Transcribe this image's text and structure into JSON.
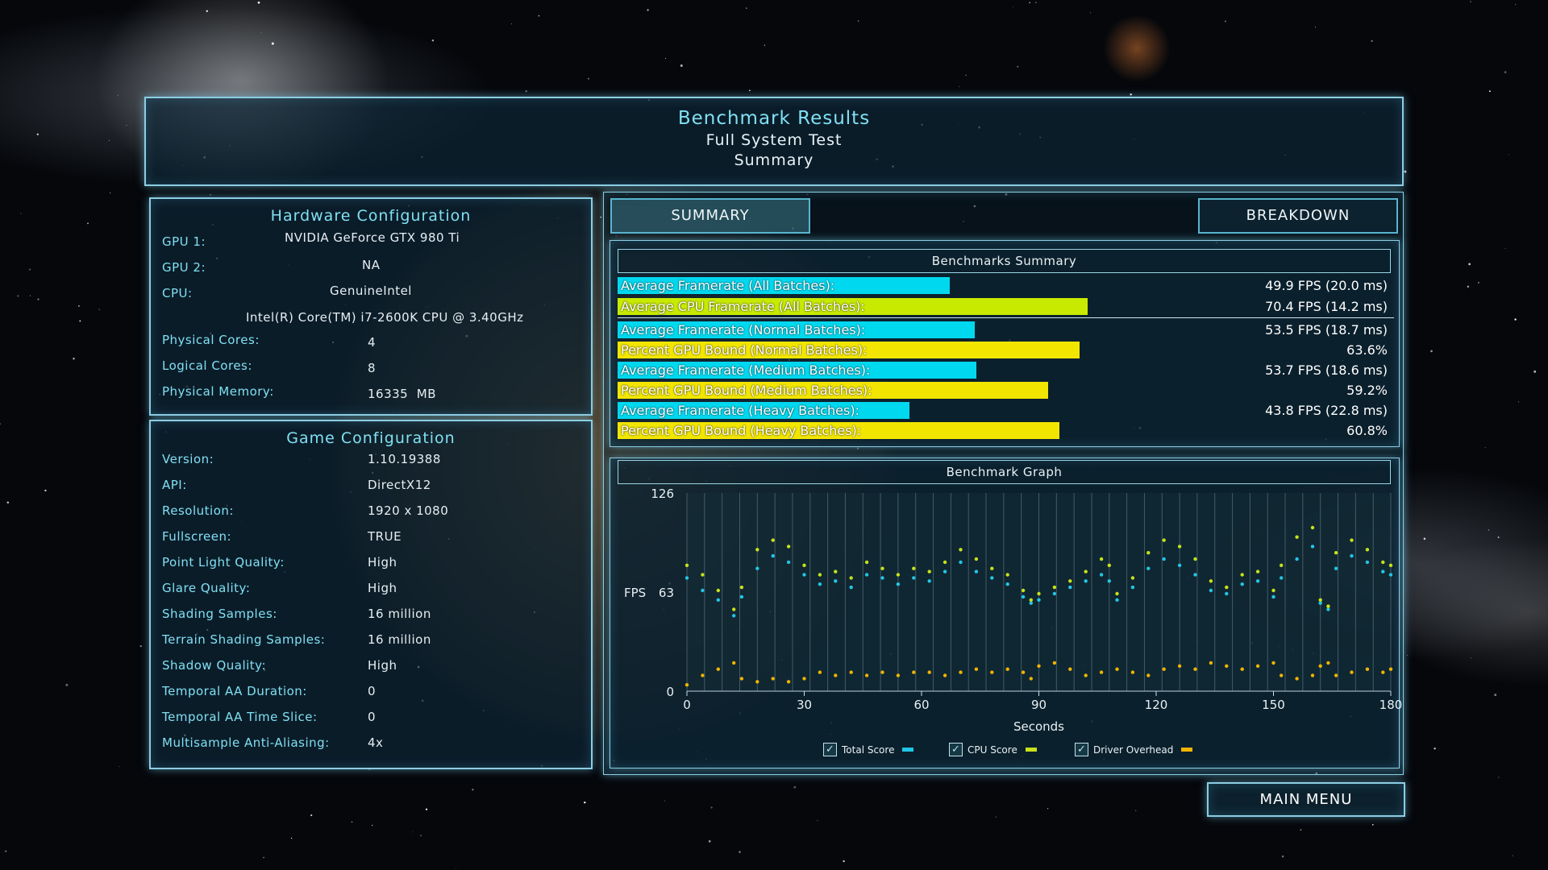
{
  "header": {
    "title": "Benchmark Results",
    "subtitle1": "Full System Test",
    "subtitle2": "Summary"
  },
  "hardware": {
    "title": "Hardware Configuration",
    "gpu1_label": "GPU 1:",
    "gpu1_value": "NVIDIA GeForce GTX 980 Ti",
    "gpu2_label": "GPU 2:",
    "gpu2_value": "NA",
    "cpu_label": "CPU:",
    "cpu_vendor": "GenuineIntel",
    "cpu_model": "Intel(R) Core(TM) i7-2600K CPU @ 3.40GHz",
    "cores_label": "Physical Cores:",
    "cores_value": "4",
    "logical_label": "Logical Cores:",
    "logical_value": "8",
    "memory_label": "Physical Memory:",
    "memory_value": "16335  MB"
  },
  "game": {
    "title": "Game Configuration",
    "rows": [
      {
        "label": "Version:",
        "value": "1.10.19388"
      },
      {
        "label": "API:",
        "value": "DirectX12"
      },
      {
        "label": "Resolution:",
        "value": "1920 x 1080"
      },
      {
        "label": "Fullscreen:",
        "value": "TRUE"
      },
      {
        "label": "Point Light Quality:",
        "value": "High"
      },
      {
        "label": "Glare Quality:",
        "value": "High"
      },
      {
        "label": "Shading Samples:",
        "value": "16 million"
      },
      {
        "label": "Terrain Shading Samples:",
        "value": "16 million"
      },
      {
        "label": "Shadow Quality:",
        "value": "High"
      },
      {
        "label": "Temporal AA Duration:",
        "value": "0"
      },
      {
        "label": "Temporal AA Time Slice:",
        "value": "0"
      },
      {
        "label": "Multisample Anti-Aliasing:",
        "value": "4x"
      }
    ]
  },
  "tabs": {
    "summary": "SUMMARY",
    "breakdown": "BREAKDOWN"
  },
  "summary": {
    "title": "Benchmarks Summary",
    "bars": [
      {
        "label": "Average Framerate (All Batches):",
        "value": "49.9 FPS (20.0 ms)",
        "fraction": 0.428,
        "color": "#00d8ef"
      },
      {
        "label": "Average CPU Framerate (All Batches):",
        "value": "70.4 FPS (14.2 ms)",
        "fraction": 0.605,
        "color": "#c8ea00"
      },
      {
        "label": "Average Framerate (Normal Batches):",
        "value": "53.5 FPS (18.7 ms)",
        "fraction": 0.46,
        "color": "#00d8ef"
      },
      {
        "label": "Percent GPU Bound (Normal Batches):",
        "value": "63.6%",
        "fraction": 0.595,
        "color": "#f2e600"
      },
      {
        "label": "Average Framerate (Medium Batches):",
        "value": "53.7 FPS (18.6 ms)",
        "fraction": 0.462,
        "color": "#00d8ef"
      },
      {
        "label": "Percent GPU Bound (Medium Batches):",
        "value": "59.2%",
        "fraction": 0.554,
        "color": "#f2e600"
      },
      {
        "label": "Average Framerate (Heavy Batches):",
        "value": "43.8 FPS (22.8 ms)",
        "fraction": 0.376,
        "color": "#00d8ef"
      },
      {
        "label": "Percent GPU Bound (Heavy Batches):",
        "value": "60.8%",
        "fraction": 0.569,
        "color": "#f2e600"
      }
    ]
  },
  "graph": {
    "title": "Benchmark Graph"
  },
  "chart_data": {
    "type": "scatter",
    "xlabel": "Seconds",
    "ylabel": "FPS",
    "xlim": [
      0,
      180
    ],
    "ylim": [
      0,
      126
    ],
    "x_ticks": [
      "0",
      "30",
      "60",
      "90",
      "120",
      "150",
      "180"
    ],
    "y_ticks": [
      "0",
      "63",
      "126"
    ],
    "series": [
      {
        "name": "Total Score",
        "color": "#22c6e6",
        "points": [
          [
            0,
            72
          ],
          [
            4,
            64
          ],
          [
            8,
            58
          ],
          [
            12,
            48
          ],
          [
            14,
            60
          ],
          [
            18,
            78
          ],
          [
            22,
            86
          ],
          [
            26,
            82
          ],
          [
            30,
            74
          ],
          [
            34,
            68
          ],
          [
            38,
            70
          ],
          [
            42,
            66
          ],
          [
            46,
            74
          ],
          [
            50,
            72
          ],
          [
            54,
            68
          ],
          [
            58,
            72
          ],
          [
            62,
            70
          ],
          [
            66,
            76
          ],
          [
            70,
            82
          ],
          [
            74,
            76
          ],
          [
            78,
            72
          ],
          [
            82,
            68
          ],
          [
            86,
            60
          ],
          [
            88,
            56
          ],
          [
            90,
            58
          ],
          [
            94,
            62
          ],
          [
            98,
            66
          ],
          [
            102,
            70
          ],
          [
            106,
            74
          ],
          [
            108,
            70
          ],
          [
            110,
            58
          ],
          [
            114,
            66
          ],
          [
            118,
            78
          ],
          [
            122,
            84
          ],
          [
            126,
            80
          ],
          [
            130,
            74
          ],
          [
            134,
            64
          ],
          [
            138,
            62
          ],
          [
            142,
            68
          ],
          [
            146,
            70
          ],
          [
            150,
            60
          ],
          [
            152,
            72
          ],
          [
            156,
            84
          ],
          [
            160,
            92
          ],
          [
            162,
            56
          ],
          [
            164,
            52
          ],
          [
            166,
            78
          ],
          [
            170,
            86
          ],
          [
            174,
            82
          ],
          [
            178,
            76
          ],
          [
            180,
            74
          ]
        ]
      },
      {
        "name": "CPU Score",
        "color": "#c7e21a",
        "points": [
          [
            0,
            80
          ],
          [
            4,
            74
          ],
          [
            8,
            64
          ],
          [
            12,
            52
          ],
          [
            14,
            66
          ],
          [
            18,
            90
          ],
          [
            22,
            96
          ],
          [
            26,
            92
          ],
          [
            30,
            80
          ],
          [
            34,
            74
          ],
          [
            38,
            76
          ],
          [
            42,
            72
          ],
          [
            46,
            82
          ],
          [
            50,
            78
          ],
          [
            54,
            74
          ],
          [
            58,
            78
          ],
          [
            62,
            76
          ],
          [
            66,
            82
          ],
          [
            70,
            90
          ],
          [
            74,
            84
          ],
          [
            78,
            78
          ],
          [
            82,
            74
          ],
          [
            86,
            64
          ],
          [
            88,
            58
          ],
          [
            90,
            62
          ],
          [
            94,
            66
          ],
          [
            98,
            70
          ],
          [
            102,
            76
          ],
          [
            106,
            84
          ],
          [
            108,
            80
          ],
          [
            110,
            62
          ],
          [
            114,
            72
          ],
          [
            118,
            88
          ],
          [
            122,
            96
          ],
          [
            126,
            92
          ],
          [
            130,
            84
          ],
          [
            134,
            70
          ],
          [
            138,
            66
          ],
          [
            142,
            74
          ],
          [
            146,
            76
          ],
          [
            150,
            64
          ],
          [
            152,
            80
          ],
          [
            156,
            98
          ],
          [
            160,
            104
          ],
          [
            162,
            58
          ],
          [
            164,
            54
          ],
          [
            166,
            88
          ],
          [
            170,
            96
          ],
          [
            174,
            90
          ],
          [
            178,
            82
          ],
          [
            180,
            80
          ]
        ]
      },
      {
        "name": "Driver Overhead",
        "color": "#f0b400",
        "points": [
          [
            0,
            4
          ],
          [
            4,
            10
          ],
          [
            8,
            14
          ],
          [
            12,
            18
          ],
          [
            14,
            8
          ],
          [
            18,
            6
          ],
          [
            22,
            8
          ],
          [
            26,
            6
          ],
          [
            30,
            8
          ],
          [
            34,
            12
          ],
          [
            38,
            10
          ],
          [
            42,
            12
          ],
          [
            46,
            10
          ],
          [
            50,
            12
          ],
          [
            54,
            10
          ],
          [
            58,
            12
          ],
          [
            62,
            12
          ],
          [
            66,
            10
          ],
          [
            70,
            12
          ],
          [
            74,
            14
          ],
          [
            78,
            12
          ],
          [
            82,
            14
          ],
          [
            86,
            12
          ],
          [
            88,
            8
          ],
          [
            90,
            16
          ],
          [
            94,
            18
          ],
          [
            98,
            14
          ],
          [
            102,
            10
          ],
          [
            106,
            12
          ],
          [
            110,
            14
          ],
          [
            114,
            12
          ],
          [
            118,
            10
          ],
          [
            122,
            14
          ],
          [
            126,
            16
          ],
          [
            130,
            14
          ],
          [
            134,
            18
          ],
          [
            138,
            16
          ],
          [
            142,
            14
          ],
          [
            146,
            16
          ],
          [
            150,
            18
          ],
          [
            152,
            10
          ],
          [
            156,
            8
          ],
          [
            160,
            10
          ],
          [
            162,
            16
          ],
          [
            164,
            18
          ],
          [
            166,
            10
          ],
          [
            170,
            12
          ],
          [
            174,
            14
          ],
          [
            178,
            12
          ],
          [
            180,
            14
          ]
        ]
      }
    ]
  },
  "legend": [
    {
      "label": "Total Score",
      "color": "#22c6e6"
    },
    {
      "label": "CPU Score",
      "color": "#c7e21a"
    },
    {
      "label": "Driver Overhead",
      "color": "#f0b400"
    }
  ],
  "checkmark": "✓",
  "main_menu": "MAIN MENU"
}
